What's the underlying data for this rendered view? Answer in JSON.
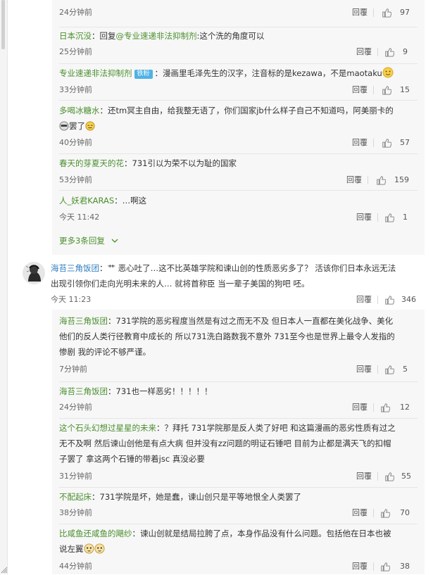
{
  "replies_top": [
    {
      "time": "24分钟前",
      "reply": "回覆",
      "likes": "97"
    },
    {
      "user": "日本沉没",
      "body_prefix": "：回复",
      "mention": "@专业速递非法抑制剂",
      "body": ":这个洗的角度可以",
      "time": "25分钟前",
      "reply": "回覆",
      "likes": "9"
    },
    {
      "user": "专业速递非法抑制剂",
      "badge": "铁粉",
      "body": "：漫画里毛泽先生的汉字，注音标的是kezawa，不是maotaku",
      "time": "33分钟前",
      "reply": "回覆",
      "likes": "15"
    },
    {
      "user": "多喝冰糖水",
      "body": "：还tm冥主自由，给我整无语了，你们国家jb什么样子自己不知道吗，阿美丽卡的",
      "body2": "罢了",
      "time": "40分钟前",
      "reply": "回覆",
      "likes": "57"
    },
    {
      "user": "春天的芽夏天的花",
      "body": "：731引以为荣不以为耻的国家",
      "time": "53分钟前",
      "reply": "回覆",
      "likes": "159"
    },
    {
      "user": "人_妖君KARAS",
      "body": "：…啊这",
      "time": "今天 11:42",
      "reply": "回覆",
      "likes": "1"
    }
  ],
  "more_replies": "更多3条回复",
  "main_comment": {
    "user": "海苔三角饭团",
    "body": "：艹 恶心吐了…这不比英雄学院和谏山创的性质恶劣多了？ 活该你们日本永远无法",
    "body2": "出现引领你们走向光明未来的人… 就将首称臣 当一辈子美国的狗吧 呸。",
    "time": "今天 11:23",
    "reply": "回覆",
    "likes": "346"
  },
  "replies_bottom": [
    {
      "user": "海苔三角饭团",
      "lines": [
        "：731学院的恶劣程度当然是有过之而无不及 但日本人一直都在美化战争、美化",
        "他们的反人类行径教育中成长的 所以731洗白路数我不意外  731至今也是世界上最令人发指的",
        "惨剧 我的评论不够严谨。"
      ],
      "time": "7分钟前",
      "reply": "回覆",
      "likes": "5"
    },
    {
      "user": "海苔三角饭团",
      "lines": [
        "：731也一样恶劣！！！！！"
      ],
      "time": "24分钟前",
      "reply": "回覆",
      "likes": "12"
    },
    {
      "user": "这个石头幻想过星星的未来",
      "lines": [
        "：？拜托 731学院那是反人类了好吧 和这篇漫画的恶劣性质有过之",
        "无不及啊 然后谏山创他是有点大病 但并没有zz问题的明证石锤吧 目前为止都是满天飞的扣帽",
        "子罢了 拿这两个石锤的带着jsc 真没必要"
      ],
      "time": "31分钟前",
      "reply": "回覆",
      "likes": "55"
    },
    {
      "user": "不配起床",
      "lines": [
        "：731学院是坏，她是蠢，谏山创只是平等地恨全人类罢了"
      ],
      "time": "38分钟前",
      "reply": "回覆",
      "likes": "70"
    },
    {
      "user": "比咸鱼还咸鱼的飓纱",
      "lines": [
        "：谏山创就是结局拉胯了点，本身作品没有什么问题。包括他在日本也被",
        "说左翼"
      ],
      "time": "44分钟前",
      "reply": "回覆",
      "likes": "38"
    }
  ],
  "colors": {
    "username_green": "#4a8f2d",
    "username_blue": "#2f7cbf",
    "sub_bg": "#f7f7f7",
    "badge_blue": "#4fb2e3"
  },
  "icons": [
    "thumbs-up-icon",
    "avatar",
    "emoji-icon"
  ]
}
